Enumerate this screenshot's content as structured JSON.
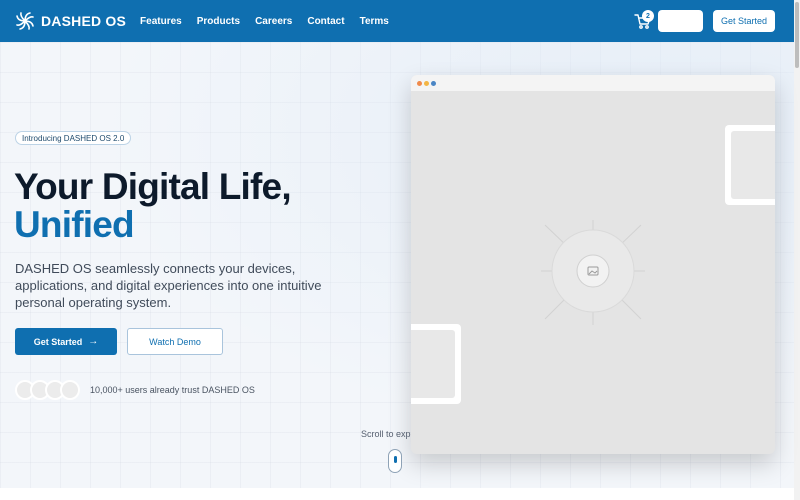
{
  "header": {
    "brand": "DASHED OS",
    "nav": [
      "Features",
      "Products",
      "Careers",
      "Contact",
      "Terms"
    ],
    "cart_count": "2",
    "cta_label": "Get Started"
  },
  "hero": {
    "badge": "Introducing DASHED OS 2.0",
    "headline_line1": "Your Digital Life,",
    "headline_line2": "Unified",
    "description": "DASHED OS seamlessly connects your devices, applications, and digital experiences into one intuitive personal operating system.",
    "primary_button": "Get Started",
    "secondary_button": "Watch Demo",
    "trust_text": "10,000+ users already trust DASHED OS",
    "scroll_hint": "Scroll to exp"
  },
  "icons": {
    "logo": "spiral-logo-icon",
    "cart": "cart-icon",
    "arrow": "arrow-right-icon",
    "image_placeholder": "image-icon",
    "play": "play-icon",
    "mouse": "mouse-scroll-icon"
  },
  "colors": {
    "brand": "#0f6fb0",
    "headline": "#0d1a2b",
    "window_dot_red": "#f08a4b",
    "window_dot_yellow": "#f3b544",
    "window_dot_blue": "#4a86c5"
  }
}
